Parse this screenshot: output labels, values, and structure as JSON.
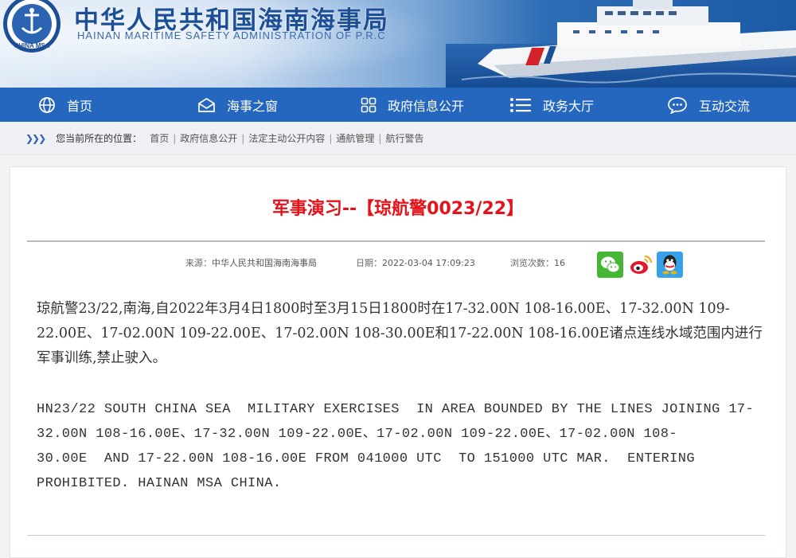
{
  "header": {
    "title_cn": "中华人民共和国海南海事局",
    "title_en": "HAINAN MARITIME SAFETY ADMINISTRATION OF P.R.C",
    "logo_text": "CHINA MSA"
  },
  "nav": {
    "items": [
      {
        "label": "首页",
        "icon": "globe-icon"
      },
      {
        "label": "海事之窗",
        "icon": "envelope-icon"
      },
      {
        "label": "政府信息公开",
        "icon": "grid-icon"
      },
      {
        "label": "政务大厅",
        "icon": "list-icon"
      },
      {
        "label": "互动交流",
        "icon": "chat-bubble-icon"
      }
    ]
  },
  "breadcrumb": {
    "prefix": "您当前所在的位置：",
    "items": [
      "首页",
      "政府信息公开",
      "法定主动公开内容",
      "通航管理",
      "航行警告"
    ]
  },
  "article": {
    "title": "军事演习--【琼航警0023/22】",
    "source_label": "来源：",
    "source": "中华人民共和国海南海事局",
    "date_label": "日期：",
    "date": "2022-03-04 17:09:23",
    "views_label": "浏览次数：",
    "views": "16",
    "share": [
      "wechat-icon",
      "weibo-icon",
      "qq-icon"
    ],
    "body_cn": "琼航警23/22,南海,自2022年3月4日1800时至3月15日1800时在17-32.00N 108-16.00E、17-32.00N 109-22.00E、17-02.00N 109-22.00E、17-02.00N 108-30.00E和17-22.00N 108-16.00E诸点连线水域范围内进行军事训练,禁止驶入。",
    "body_en": "HN23/22 SOUTH CHINA SEA  MILITARY EXERCISES  IN AREA BOUNDED BY THE LINES JOINING 17-\n32.00N 108-16.00E、17-32.00N 109-22.00E、17-02.00N 109-22.00E、17-02.00N 108-\n30.00E  AND 17-22.00N 108-16.00E FROM 041000 UTC  TO 151000 UTC MAR.  ENTERING\nPROHIBITED. HAINAN MSA CHINA."
  },
  "colors": {
    "nav_bg": "#2566bf",
    "title_red": "#e4121b",
    "brand_blue": "#1d4f97"
  }
}
